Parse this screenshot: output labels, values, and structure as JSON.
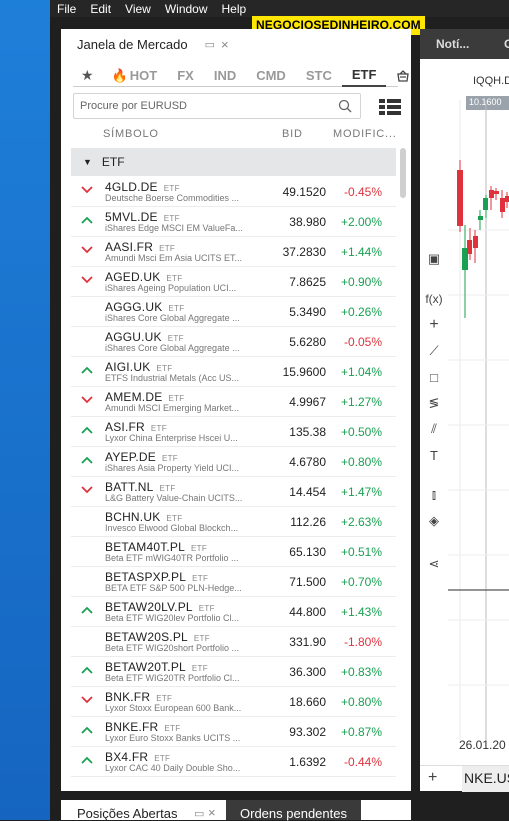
{
  "menu": [
    "File",
    "Edit",
    "View",
    "Window",
    "Help"
  ],
  "brand": "NEGOCIOSEDINHEIRO.COM",
  "panel": {
    "title": "Janela de Mercado",
    "tabs": [
      "★",
      "HOT",
      "FX",
      "IND",
      "CMD",
      "STC",
      "ETF"
    ],
    "active_tab": "ETF",
    "search_placeholder": "Procure por EURUSD",
    "columns": {
      "symbol": "SÍMBOLO",
      "bid": "BID",
      "change": "MODIFIC..."
    },
    "group": "ETF",
    "type_label": "ETF",
    "rows": [
      {
        "sym": "4GLD.DE",
        "desc": "Deutsche Boerse Commodities ...",
        "bid": "49.1520",
        "chg": "-0.45%",
        "dir": "down",
        "arrow": "down"
      },
      {
        "sym": "5MVL.DE",
        "desc": "iShares Edge MSCI EM ValueFa...",
        "bid": "38.980",
        "chg": "+2.00%",
        "dir": "up",
        "arrow": "up"
      },
      {
        "sym": "AASI.FR",
        "desc": "Amundi Msci Em Asia UCITS ET...",
        "bid": "37.2830",
        "chg": "+1.44%",
        "dir": "up",
        "arrow": "down"
      },
      {
        "sym": "AGED.UK",
        "desc": "iShares Ageing Population UCI...",
        "bid": "7.8625",
        "chg": "+0.90%",
        "dir": "up",
        "arrow": "down"
      },
      {
        "sym": "AGGG.UK",
        "desc": "iShares Core Global Aggregate ...",
        "bid": "5.3490",
        "chg": "+0.26%",
        "dir": "up",
        "arrow": "none"
      },
      {
        "sym": "AGGU.UK",
        "desc": "iShares Core Global Aggregate ...",
        "bid": "5.6280",
        "chg": "-0.05%",
        "dir": "down",
        "arrow": "none"
      },
      {
        "sym": "AIGI.UK",
        "desc": "ETFS Industrial Metals (Acc US...",
        "bid": "15.9600",
        "chg": "+1.04%",
        "dir": "up",
        "arrow": "up"
      },
      {
        "sym": "AMEM.DE",
        "desc": "Amundi MSCI Emerging Market...",
        "bid": "4.9967",
        "chg": "+1.27%",
        "dir": "up",
        "arrow": "down"
      },
      {
        "sym": "ASI.FR",
        "desc": "Lyxor China Enterprise Hscei U...",
        "bid": "135.38",
        "chg": "+0.50%",
        "dir": "up",
        "arrow": "up"
      },
      {
        "sym": "AYEP.DE",
        "desc": "iShares Asia Property Yield UCI...",
        "bid": "4.6780",
        "chg": "+0.80%",
        "dir": "up",
        "arrow": "up"
      },
      {
        "sym": "BATT.NL",
        "desc": "L&G Battery Value-Chain UCITS...",
        "bid": "14.454",
        "chg": "+1.47%",
        "dir": "up",
        "arrow": "down"
      },
      {
        "sym": "BCHN.UK",
        "desc": "Invesco Elwood Global Blockch...",
        "bid": "112.26",
        "chg": "+2.63%",
        "dir": "up",
        "arrow": "none"
      },
      {
        "sym": "BETAM40T.PL",
        "desc": "Beta ETF mWIG40TR Portfolio ...",
        "bid": "65.130",
        "chg": "+0.51%",
        "dir": "up",
        "arrow": "none"
      },
      {
        "sym": "BETASPXP.PL",
        "desc": "BETA ETF S&P 500 PLN-Hedge...",
        "bid": "71.500",
        "chg": "+0.70%",
        "dir": "up",
        "arrow": "none"
      },
      {
        "sym": "BETAW20LV.PL",
        "desc": "Beta ETF WIG20lev Portfolio Cl...",
        "bid": "44.800",
        "chg": "+1.43%",
        "dir": "up",
        "arrow": "up"
      },
      {
        "sym": "BETAW20S.PL",
        "desc": "Beta ETF WIG20short Portfolio ...",
        "bid": "331.90",
        "chg": "-1.80%",
        "dir": "down",
        "arrow": "none"
      },
      {
        "sym": "BETAW20T.PL",
        "desc": "Beta ETF WIG20TR Portfolio Cl...",
        "bid": "36.300",
        "chg": "+0.83%",
        "dir": "up",
        "arrow": "up"
      },
      {
        "sym": "BNK.FR",
        "desc": "Lyxor Stoxx European 600 Bank...",
        "bid": "18.660",
        "chg": "+0.80%",
        "dir": "up",
        "arrow": "down"
      },
      {
        "sym": "BNKE.FR",
        "desc": "Lyxor Euro Stoxx Banks UCITS ...",
        "bid": "93.302",
        "chg": "+0.87%",
        "dir": "up",
        "arrow": "up"
      },
      {
        "sym": "BX4.FR",
        "desc": "Lyxor CAC 40 Daily Double Sho...",
        "bid": "1.6392",
        "chg": "-0.44%",
        "dir": "down",
        "arrow": "up"
      }
    ]
  },
  "bottom": {
    "tab1": "Posições Abertas",
    "tab2": "Ordens pendentes"
  },
  "right": {
    "tab1": "Notí...",
    "tab2": "C",
    "chart_symbol": "IQQH.D",
    "price_box": "10.1600",
    "date_label": "26.01.20",
    "symbol_tab": "NKE.US"
  },
  "colors": {
    "up": "#1aa052",
    "down": "#e0323c",
    "brand_bg": "#ffe600"
  }
}
